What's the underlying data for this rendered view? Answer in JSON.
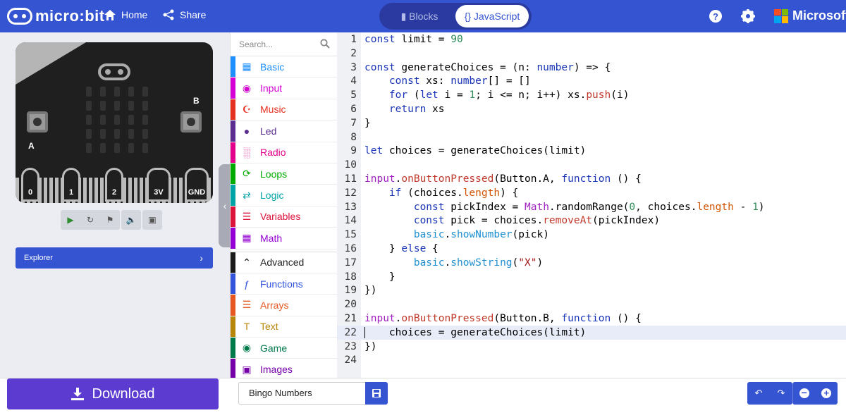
{
  "header": {
    "logo_text": "micro:bit",
    "home_label": "Home",
    "share_label": "Share",
    "blocks_label": "Blocks",
    "javascript_label": "{} JavaScript",
    "brand": "Microsoft",
    "accent": "#3454d1"
  },
  "simulator": {
    "pins": [
      "0",
      "1",
      "2",
      "3V",
      "GND"
    ],
    "button_a": "A",
    "button_b": "B",
    "controls": [
      "play-icon",
      "restart-icon",
      "debug-icon",
      "mute-icon",
      "fullscreen-icon"
    ],
    "explorer_label": "Explorer"
  },
  "toolbox": {
    "search_placeholder": "Search...",
    "categories": [
      {
        "label": "Basic",
        "color": "#1e90ff",
        "icon": "grid-icon"
      },
      {
        "label": "Input",
        "color": "#d400d4",
        "icon": "radio-button-icon"
      },
      {
        "label": "Music",
        "color": "#e63022",
        "icon": "headphones-icon"
      },
      {
        "label": "Led",
        "color": "#5c2d91",
        "icon": "toggle-icon"
      },
      {
        "label": "Radio",
        "color": "#e3008c",
        "icon": "signal-bars-icon"
      },
      {
        "label": "Loops",
        "color": "#00aa00",
        "icon": "refresh-icon"
      },
      {
        "label": "Logic",
        "color": "#00a4a6",
        "icon": "shuffle-icon"
      },
      {
        "label": "Variables",
        "color": "#dc143c",
        "icon": "lines-icon"
      },
      {
        "label": "Math",
        "color": "#9400d3",
        "icon": "calculator-icon"
      }
    ],
    "advanced_label": "Advanced",
    "advanced_categories": [
      {
        "label": "Functions",
        "color": "#3455db",
        "icon": "function-icon"
      },
      {
        "label": "Arrays",
        "color": "#e65722",
        "icon": "list-icon"
      },
      {
        "label": "Text",
        "color": "#b8860b",
        "icon": "text-icon"
      },
      {
        "label": "Game",
        "color": "#007a4b",
        "icon": "gamepad-icon"
      },
      {
        "label": "Images",
        "color": "#7600a8",
        "icon": "image-icon"
      }
    ]
  },
  "editor": {
    "current_line": 22,
    "lines": [
      "const limit = 90",
      "",
      "const generateChoices = (n: number) => {",
      "    const xs: number[] = []",
      "    for (let i = 1; i <= n; i++) xs.push(i)",
      "    return xs",
      "}",
      "",
      "let choices = generateChoices(limit)",
      "",
      "input.onButtonPressed(Button.A, function () {",
      "    if (choices.length) {",
      "        const pickIndex = Math.randomRange(0, choices.length - 1)",
      "        const pick = choices.removeAt(pickIndex)",
      "        basic.showNumber(pick)",
      "    } else {",
      "        basic.showString(\"X\")",
      "    }",
      "})",
      "",
      "input.onButtonPressed(Button.B, function () {",
      "    choices = generateChoices(limit)",
      "})",
      ""
    ]
  },
  "bottom": {
    "download_label": "Download",
    "project_name": "Bingo Numbers",
    "download_color": "#5c3bd1"
  }
}
